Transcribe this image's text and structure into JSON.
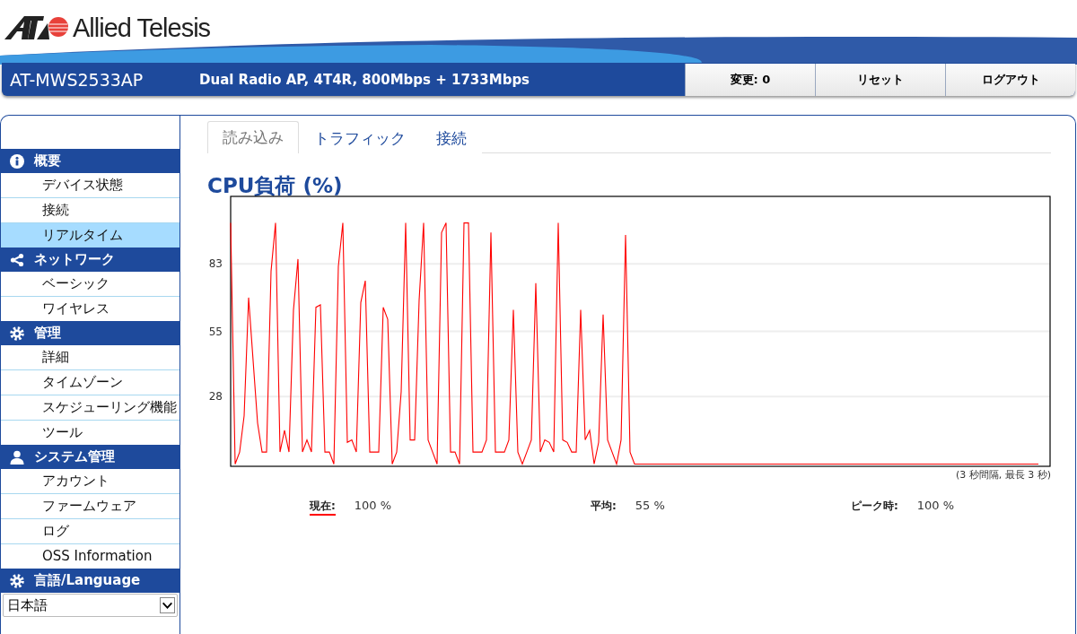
{
  "header": {
    "logo_text": "Allied Telesis",
    "model": "AT-MWS2533AP",
    "description": "Dual Radio AP, 4T4R, 800Mbps + 1733Mbps",
    "buttons": [
      {
        "label": "変更: 0"
      },
      {
        "label": "リセット"
      },
      {
        "label": "ログアウト"
      }
    ]
  },
  "sidebar": {
    "sections": [
      {
        "title": "概要",
        "items": [
          {
            "label": "デバイス状態",
            "selected": false
          },
          {
            "label": "接続",
            "selected": false
          },
          {
            "label": "リアルタイム",
            "selected": true
          }
        ]
      },
      {
        "title": "ネットワーク",
        "items": [
          {
            "label": "ベーシック",
            "selected": false
          },
          {
            "label": "ワイヤレス",
            "selected": false
          }
        ]
      },
      {
        "title": "管理",
        "items": [
          {
            "label": "詳細",
            "selected": false
          },
          {
            "label": "タイムゾーン",
            "selected": false
          },
          {
            "label": "スケジューリング機能",
            "selected": false
          },
          {
            "label": "ツール",
            "selected": false
          }
        ]
      },
      {
        "title": "システム管理",
        "items": [
          {
            "label": "アカウント",
            "selected": false
          },
          {
            "label": "ファームウェア",
            "selected": false
          },
          {
            "label": "ログ",
            "selected": false
          },
          {
            "label": "OSS Information",
            "selected": false
          }
        ]
      },
      {
        "title": "言語/Language"
      }
    ],
    "language": {
      "value": "日本語"
    }
  },
  "tabs": [
    {
      "label": "読み込み",
      "selected": true
    },
    {
      "label": "トラフィック",
      "selected": false
    },
    {
      "label": "接続",
      "selected": false
    }
  ],
  "panel": {
    "title": "CPU負荷 (%)",
    "chart_data": {
      "type": "line",
      "grid": true,
      "ylim": [
        0,
        111
      ],
      "yticks": [
        28,
        55,
        83
      ],
      "series": [
        {
          "color": "#ff0000",
          "values": [
            100,
            0,
            5,
            20,
            69,
            43,
            17,
            5,
            5,
            80,
            100,
            5,
            14,
            5,
            64,
            85,
            5,
            10,
            5,
            65,
            66,
            5,
            5,
            0,
            82,
            100,
            9,
            10,
            5,
            67,
            76,
            5,
            5,
            5,
            65,
            60,
            0,
            5,
            30,
            100,
            10,
            10,
            68,
            100,
            10,
            5,
            0,
            96,
            100,
            5,
            5,
            0,
            100,
            100,
            5,
            5,
            5,
            10,
            96,
            5,
            5,
            5,
            10,
            64,
            5,
            0,
            5,
            10,
            75,
            5,
            10,
            9,
            5,
            100,
            10,
            9,
            5,
            5,
            64,
            10,
            14,
            0,
            9,
            62,
            10,
            5,
            0,
            10,
            95,
            5,
            0,
            0,
            0,
            0,
            0,
            0,
            0,
            0,
            0,
            0,
            0,
            0,
            0,
            0,
            0,
            0,
            0,
            0,
            0,
            0,
            0,
            0,
            0,
            0,
            0,
            0,
            0,
            0,
            0,
            0,
            0,
            0,
            0,
            0,
            0,
            0,
            0,
            0,
            0,
            0,
            0,
            0,
            0,
            0,
            0,
            0,
            0,
            0,
            0,
            0,
            0,
            0,
            0,
            0,
            0,
            0,
            0,
            0,
            0,
            0,
            0,
            0,
            0,
            0,
            0,
            0,
            0,
            0,
            0,
            0,
            0,
            0,
            0,
            0,
            0,
            0,
            0,
            0,
            0,
            0,
            0,
            0,
            0,
            0,
            0,
            0,
            0,
            0,
            0,
            0,
            0
          ]
        }
      ]
    },
    "note": "(3 秒間隔, 最長 3 秒)",
    "stats": [
      {
        "kind": "legend",
        "label": "現在:",
        "value": "100 %"
      },
      {
        "kind": "plain",
        "label": "平均:",
        "value": "55 %"
      },
      {
        "kind": "plain",
        "label": "ピーク時:",
        "value": "100 %"
      }
    ]
  }
}
